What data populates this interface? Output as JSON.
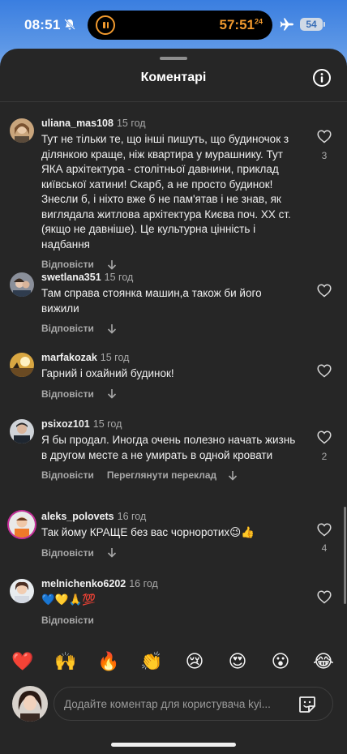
{
  "status_bar": {
    "time": "08:51",
    "timer": "57:51",
    "timer_sub": "24",
    "battery": "54"
  },
  "sheet": {
    "title": "Коментарі"
  },
  "comments": [
    {
      "username": "uliana_mas108",
      "time": "15 год",
      "text": "Тут не тільки те, що інші пишуть, що будиночок з ділянкою краще, ніж квартира у мурашнику. Тут ЯКА архітектура - столітньої давнини, приклад київської хатини! Скарб, а не просто будинок! Знесли б, і ніхто вже б не пам'ятав і не знав, як виглядала житлова архітектура Києва поч. ХХ ст. (якщо не давніше). Це культурна цінність і надбання",
      "reply_label": "Відповісти",
      "likes": "3"
    },
    {
      "username": "swetlana351",
      "time": "15 год",
      "text": "Там справа стоянка машин,а також би його вижили",
      "reply_label": "Відповісти",
      "likes": ""
    },
    {
      "username": "marfakozak",
      "time": "15 год",
      "text": "Гарний і охайний будинок!",
      "reply_label": "Відповісти",
      "likes": ""
    },
    {
      "username": "psixoz101",
      "time": "15 год",
      "text": "Я бы продал. Иногда очень полезно начать жизнь в другом месте а не умирать в одной кровати",
      "reply_label": "Відповісти",
      "translate_label": "Переглянути переклад",
      "likes": "2"
    },
    {
      "username": "aleks_polovets",
      "time": "16 год",
      "text": "Так йому КРАЩЕ без вас чорноротих😉👍",
      "reply_label": "Відповісти",
      "likes": "4"
    },
    {
      "username": "melnichenko6202",
      "time": "16 год",
      "text": "💙💛🙏💯",
      "reply_label": "Відповісти",
      "likes": ""
    }
  ],
  "emoji_bar": [
    "❤️",
    "🙌",
    "🔥",
    "👏",
    "😢",
    "😍",
    "😮",
    "😂"
  ],
  "composer": {
    "placeholder": "Додайте коментар для користувача kyi..."
  },
  "colors": {
    "sheet_bg": "#262626",
    "timer_accent": "#f29a2e",
    "muted_text": "#a8a8a8"
  }
}
